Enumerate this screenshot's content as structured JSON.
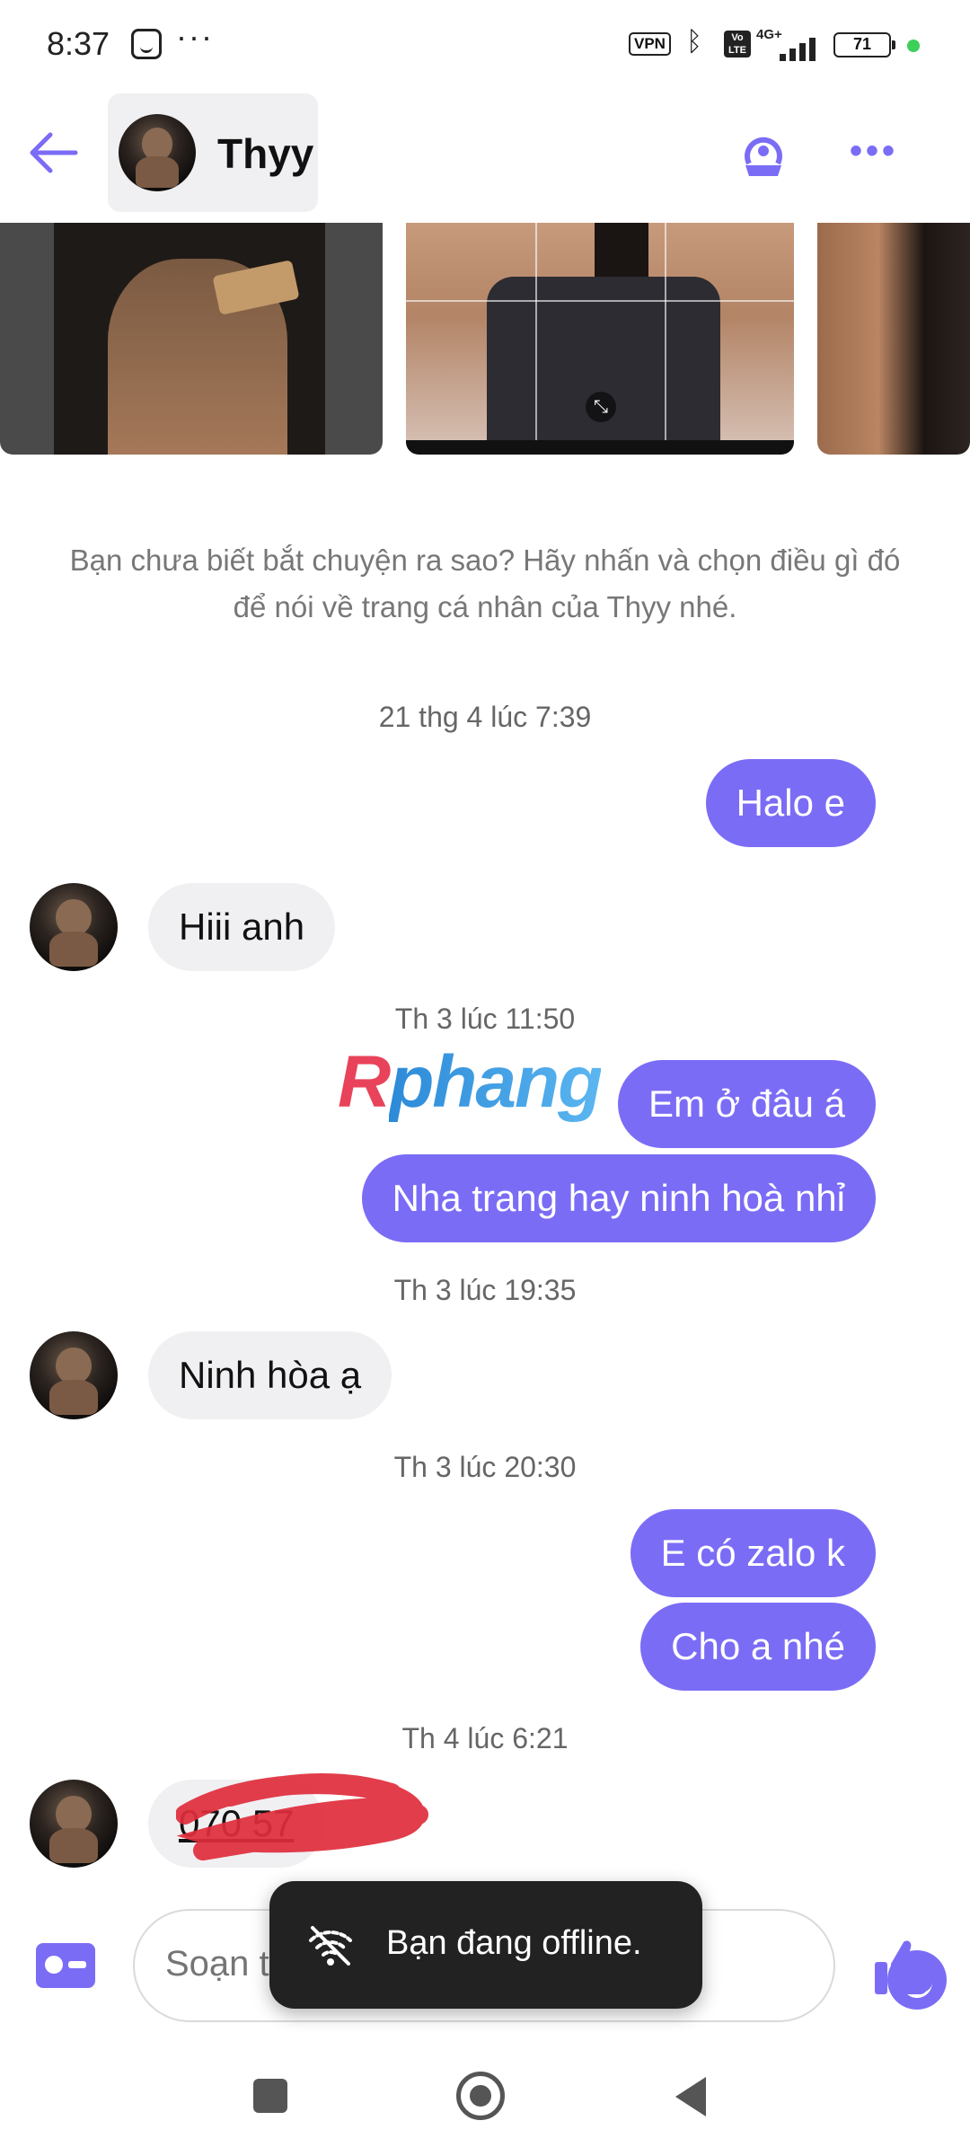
{
  "status_bar": {
    "time": "8:37",
    "vpn_label": "VPN",
    "volte_label": "Vo LTE",
    "network_label": "4G+",
    "battery_level": "71",
    "icons": [
      "face-icon",
      "bluetooth-icon",
      "signal-icon",
      "battery-icon"
    ]
  },
  "header": {
    "contact_name": "Thyy",
    "icons": [
      "back-arrow-icon",
      "call-icon",
      "more-icon"
    ],
    "accent_color": "#7b6cf6"
  },
  "suggestion": {
    "text": "Bạn chưa biết bắt chuyện ra sao? Hãy nhấn và chọn điều gì đó để nói về trang cá nhân của Thyy nhé."
  },
  "conversation": {
    "timestamps": [
      "21 thg 4 lúc 7:39",
      "Th 3 lúc 11:50",
      "Th 3 lúc 19:35",
      "Th 3 lúc 20:30",
      "Th 4 lúc 6:21"
    ],
    "messages": [
      {
        "direction": "out",
        "text": "Halo e"
      },
      {
        "direction": "in",
        "text": "Hiii anh"
      },
      {
        "direction": "out",
        "text": "Em ở đâu á"
      },
      {
        "direction": "out",
        "text": "Nha trang hay ninh hoà nhỉ"
      },
      {
        "direction": "in",
        "text": "Ninh hòa ạ"
      },
      {
        "direction": "out",
        "text": "E có zalo k"
      },
      {
        "direction": "out",
        "text": "Cho a nhé"
      },
      {
        "direction": "in",
        "text": "070         57"
      }
    ]
  },
  "watermark": {
    "first": "R",
    "rest": "phang"
  },
  "composer": {
    "placeholder": "Soạn t",
    "icons": [
      "contact-card-icon",
      "emoji-icon",
      "thumbs-up-icon"
    ]
  },
  "toast": {
    "text": "Bạn đang offline.",
    "icon": "wifi-off-icon"
  },
  "nav": {
    "icons": [
      "recents-icon",
      "home-icon",
      "back-icon"
    ]
  }
}
